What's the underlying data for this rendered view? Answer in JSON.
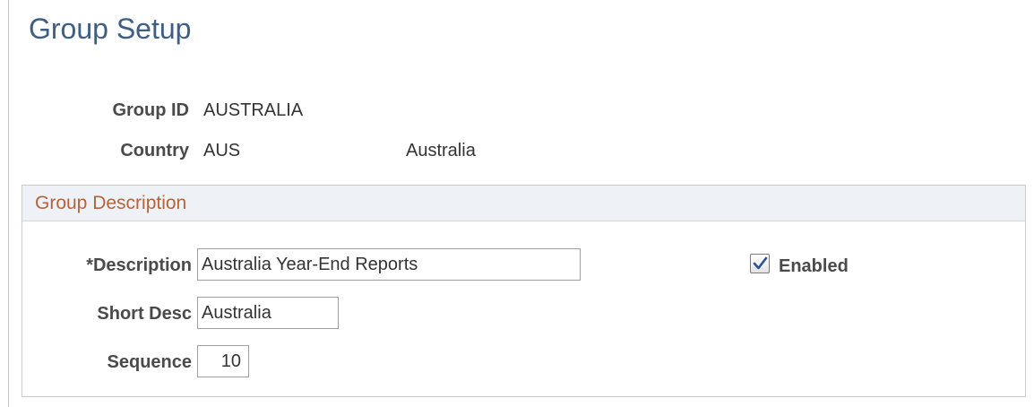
{
  "page": {
    "title": "Group Setup"
  },
  "header_fields": {
    "group_id": {
      "label": "Group ID",
      "value": "AUSTRALIA"
    },
    "country": {
      "label": "Country",
      "code": "AUS",
      "name": "Australia"
    }
  },
  "group_description": {
    "title": "Group Description",
    "description": {
      "label": "*Description",
      "value": "Australia Year-End Reports"
    },
    "short_desc": {
      "label": "Short Desc",
      "value": "Australia"
    },
    "sequence": {
      "label": "Sequence",
      "value": "10"
    },
    "enabled": {
      "label": "Enabled",
      "checked": true
    }
  },
  "colors": {
    "title": "#3f5e84",
    "section_title": "#b4643a",
    "section_header_bg": "#eef2f6",
    "check_mark": "#2a5490"
  },
  "icons": {
    "enabled_checkbox": "checkmark-icon"
  }
}
